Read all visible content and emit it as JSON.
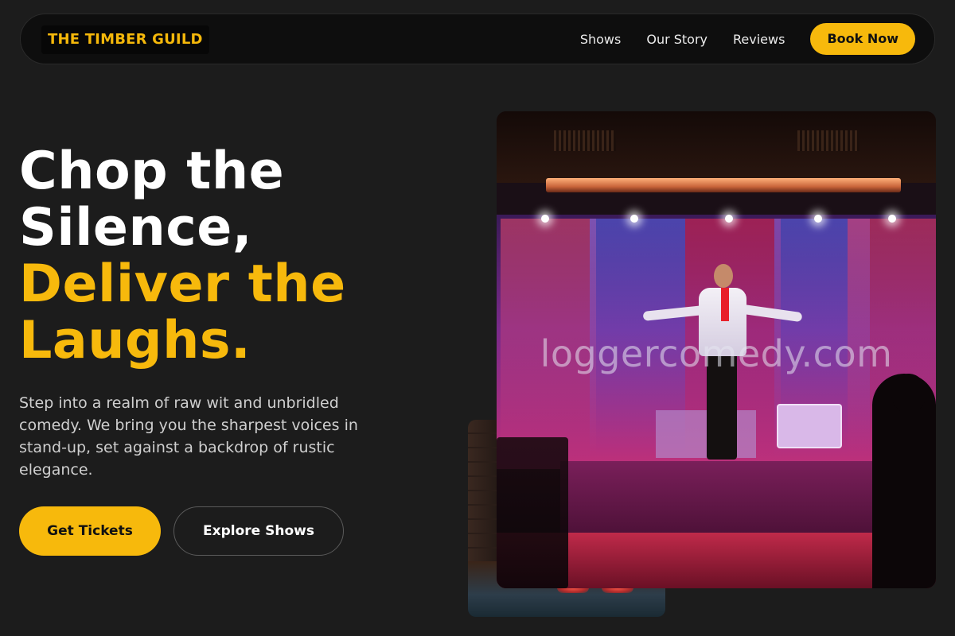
{
  "nav": {
    "logo": "THE TIMBER GUILD",
    "links": [
      "Shows",
      "Our Story",
      "Reviews"
    ],
    "cta": "Book Now"
  },
  "hero": {
    "headline_white": "Chop the Silence,",
    "headline_accent": "Deliver the Laughs.",
    "subtext": "Step into a realm of raw wit and unbridled comedy. We bring you the sharpest voices in stand-up, set against a backdrop of rustic elegance.",
    "primary_button": "Get Tickets",
    "secondary_button": "Explore Shows"
  },
  "images": {
    "main_watermark": "loggercomedy.com",
    "main_icon": "comedian-on-stage-photo",
    "back_icon": "stage-lights-photo"
  },
  "colors": {
    "background": "#1c1c1c",
    "accent": "#f7b90c",
    "nav_background": "#0e0e0e"
  }
}
